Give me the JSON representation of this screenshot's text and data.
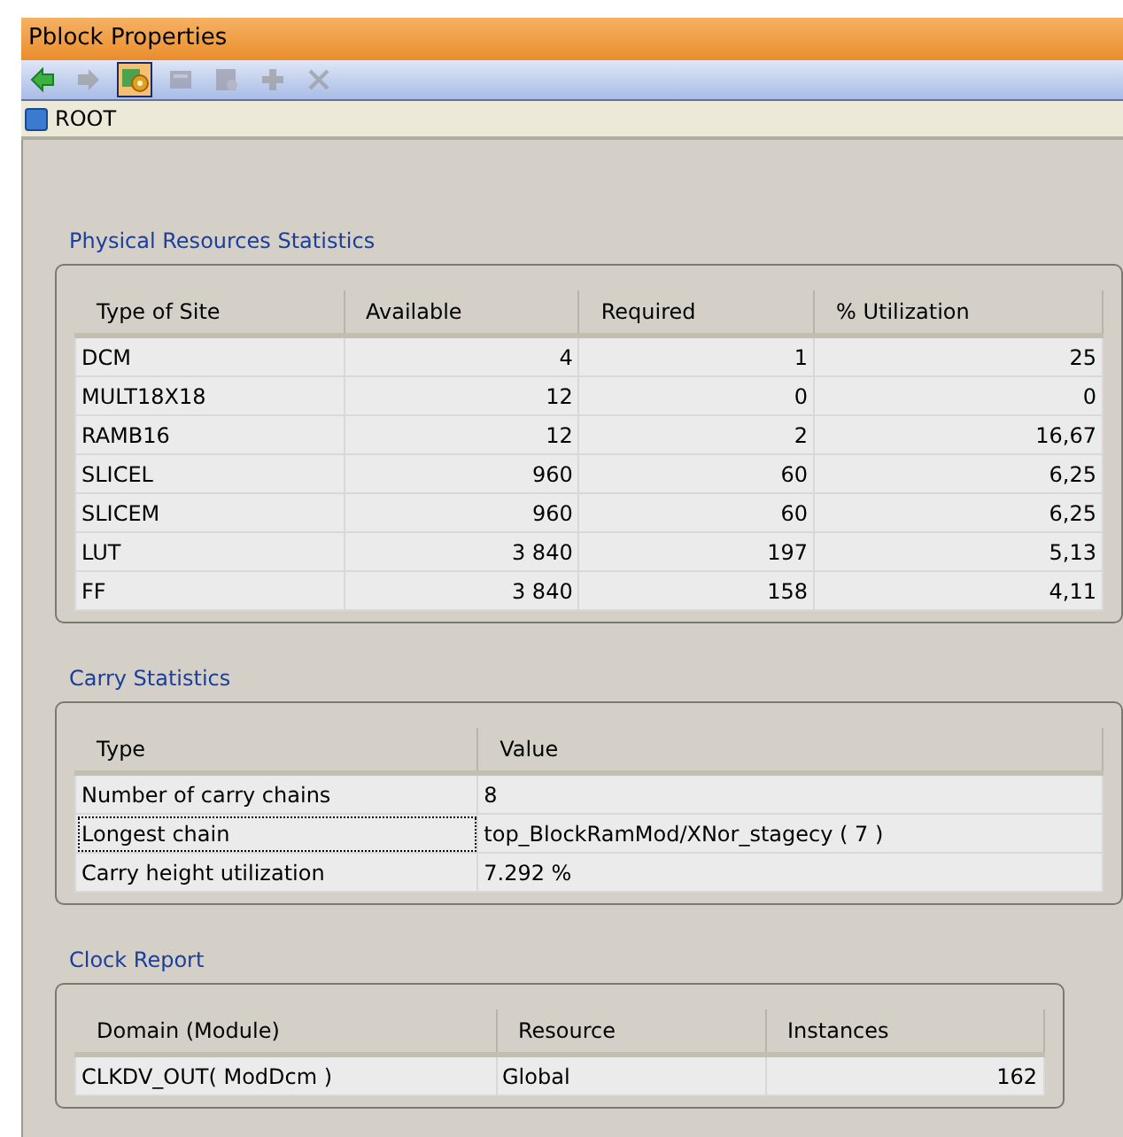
{
  "window": {
    "title": "Pblock Properties"
  },
  "toolbar": [
    {
      "kind": "back",
      "disabled": false,
      "selected": false
    },
    {
      "kind": "forward",
      "disabled": true,
      "selected": false
    },
    {
      "kind": "properties",
      "disabled": false,
      "selected": true
    },
    {
      "kind": "sheet",
      "disabled": true,
      "selected": false
    },
    {
      "kind": "sheet-search",
      "disabled": true,
      "selected": false
    },
    {
      "kind": "add",
      "disabled": true,
      "selected": false
    },
    {
      "kind": "delete",
      "disabled": true,
      "selected": false
    }
  ],
  "breadcrumb": {
    "label": "ROOT"
  },
  "sections": [
    {
      "title": "Physical Resources Statistics",
      "columns": [
        {
          "label": "Type of Site",
          "kind": "text"
        },
        {
          "label": "Available",
          "kind": "number"
        },
        {
          "label": "Required",
          "kind": "number"
        },
        {
          "label": "% Utilization",
          "kind": "number"
        }
      ],
      "rows": [
        {
          "cells": [
            "DCM",
            "4",
            "1",
            "25"
          ],
          "selected": false
        },
        {
          "cells": [
            "MULT18X18",
            "12",
            "0",
            "0"
          ],
          "selected": false
        },
        {
          "cells": [
            "RAMB16",
            "12",
            "2",
            "16,67"
          ],
          "selected": false
        },
        {
          "cells": [
            "SLICEL",
            "960",
            "60",
            "6,25"
          ],
          "selected": false
        },
        {
          "cells": [
            "SLICEM",
            "960",
            "60",
            "6,25"
          ],
          "selected": false
        },
        {
          "cells": [
            "LUT",
            "3 840",
            "197",
            "5,13"
          ],
          "selected": false
        },
        {
          "cells": [
            "FF",
            "3 840",
            "158",
            "4,11"
          ],
          "selected": false
        }
      ]
    },
    {
      "title": "Carry Statistics",
      "columns": [
        {
          "label": "Type",
          "kind": "text"
        },
        {
          "label": "Value",
          "kind": "text"
        }
      ],
      "rows": [
        {
          "cells": [
            "Number of carry chains",
            "8"
          ],
          "selected": false
        },
        {
          "cells": [
            "Longest chain",
            "top_BlockRamMod/XNor_stagecy ( 7 )"
          ],
          "selected": true
        },
        {
          "cells": [
            "Carry height utilization",
            "7.292 %"
          ],
          "selected": false
        }
      ]
    },
    {
      "title": "Clock Report",
      "columns": [
        {
          "label": "Domain (Module)",
          "kind": "text"
        },
        {
          "label": "Resource",
          "kind": "text"
        },
        {
          "label": "Instances",
          "kind": "number"
        }
      ],
      "rows": [
        {
          "cells": [
            "CLKDV_OUT( ModDcm )",
            "Global",
            "162"
          ],
          "selected": false
        }
      ]
    }
  ]
}
